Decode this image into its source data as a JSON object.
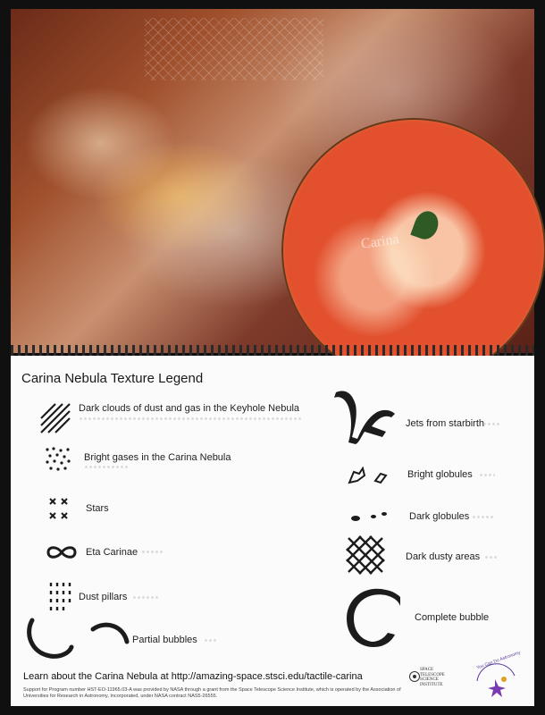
{
  "legend": {
    "title": "Carina Nebula Texture Legend",
    "left_items": [
      {
        "label": "Dark clouds of dust and gas in the Keyhole Nebula",
        "symbol": "diagonal-lines-icon"
      },
      {
        "label": "Bright gases in the Carina Nebula",
        "symbol": "dot-cluster-icon"
      },
      {
        "label": "Stars",
        "symbol": "x-marks-icon"
      },
      {
        "label": "Eta Carinae",
        "symbol": "infinity-icon"
      },
      {
        "label": "Dust pillars",
        "symbol": "vertical-dashes-icon"
      },
      {
        "label": "Partial bubbles",
        "symbol": "arc-icon"
      }
    ],
    "right_items": [
      {
        "label": "Jets from starbirth",
        "symbol": "jet-shape-icon"
      },
      {
        "label": "Bright globules",
        "symbol": "bright-globule-icon"
      },
      {
        "label": "Dark globules",
        "symbol": "dark-globule-icon"
      },
      {
        "label": "Dark dusty areas",
        "symbol": "crosshatch-icon"
      },
      {
        "label": "Complete bubble",
        "symbol": "ring-icon"
      }
    ]
  },
  "footer": {
    "link_text": "Learn about the Carina Nebula at http://amazing-space.stsci.edu/tactile-carina",
    "fine_print": "Support for Program number HST-EO-11965.03-A was provided by NASA through a grant from the Space Telescope Science Institute, which is operated by the Association of Universities for Research in Astronomy, Incorporated, under NASA contract NAS5-26555.",
    "stsci_logo_text": "SPACE TELESCOPE SCIENCE INSTITUTE",
    "ycda_logo_text": "You Can Do Astronomy"
  },
  "photo": {
    "pizza_text": "Carina"
  },
  "colors": {
    "card": "#fbfbfb",
    "symbol": "#1c1c1c",
    "nebula_dark": "#6b2a18",
    "pizza_sauce": "#e2502e"
  }
}
